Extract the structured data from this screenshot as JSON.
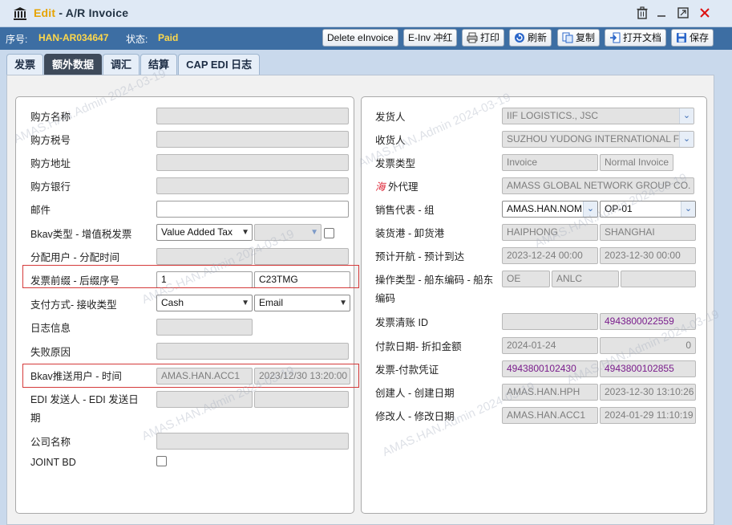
{
  "window": {
    "title_mode": "Edit",
    "title_sep": " - ",
    "title_name": "A/R Invoice"
  },
  "info": {
    "seq_label": "序号:",
    "seq_value": "HAN-AR034647",
    "status_label": "状态:",
    "status_value": "Paid"
  },
  "toolbar": {
    "delete_einvoice": "Delete eInvoice",
    "einv_offset": "E-Inv 冲红",
    "print": "打印",
    "refresh": "刷新",
    "copy": "复制",
    "open_doc": "打开文档",
    "save": "保存"
  },
  "tabs": [
    "发票",
    "额外数据",
    "调汇",
    "结算",
    "CAP EDI 日志"
  ],
  "left": {
    "buyer_name": "购方名称",
    "buyer_tax": "购方税号",
    "buyer_address": "购方地址",
    "buyer_bank": "购方银行",
    "email": "邮件",
    "bkav_type": "Bkav类型 - 增值税发票",
    "bkav_type_value": "Value Added Tax",
    "assign": "分配用户 - 分配时间",
    "prefix": "发票前缀 - 后缀序号",
    "prefix_value": "1",
    "suffix_value": "C23TMG",
    "payment": "支付方式- 接收类型",
    "payment_value": "Cash",
    "receive_value": "Email",
    "log": "日志信息",
    "fail": "失败原因",
    "bkav_push": "Bkav推送用户 - 时间",
    "bkav_push_user": "AMAS.HAN.ACC1",
    "bkav_push_time": "2023/12/30 13:20:00",
    "edi_line1": "EDI 发送人 - EDI 发送日",
    "edi_line2": "期",
    "company": "公司名称",
    "joint_bd": "JOINT BD"
  },
  "right": {
    "shipper": "发货人",
    "shipper_value": "IIF LOGISTICS., JSC",
    "consignee": "收货人",
    "consignee_value": "SUZHOU YUDONG INTERNATIONAL F",
    "inv_type": "发票类型",
    "inv_type_value": "Invoice",
    "inv_type_value2": "Normal Invoice",
    "agent_icon": "海",
    "agent": "外代理",
    "agent_value": "AMASS GLOBAL NETWORK GROUP CO.",
    "sales": "销售代表 - 组",
    "sales_value": "AMAS.HAN.NOM",
    "sales_group": "OP-01",
    "ports": "装货港 - 卸货港",
    "pol": "HAIPHONG",
    "pod": "SHANGHAI",
    "etd_eta": "预计开航 - 预计到达",
    "etd": "2023-12-24 00:00",
    "eta": "2023-12-30 00:00",
    "op_line1": "操作类型 - 船东编码 - 船东",
    "op_line2": "编码",
    "op_type": "OE",
    "carrier_code": "ANLC",
    "settle_id": "发票清账 ID",
    "settle_id_value": "4943800022559",
    "pay_date": "付款日期- 折扣金额",
    "pay_date_value": "2024-01-24",
    "discount_value": "0",
    "inv_voucher": "发票-付款凭证",
    "inv_no": "4943800102430",
    "voucher_no": "4943800102855",
    "creator": "创建人 - 创建日期",
    "creator_value": "AMAS.HAN.HPH",
    "created_value": "2023-12-30 13:10:26",
    "modifier": "修改人 - 修改日期",
    "modifier_value": "AMAS.HAN.ACC1",
    "modified_value": "2024-01-29 11:10:19"
  },
  "watermark": "AMAS.HAN.Admin 2024-03-19"
}
